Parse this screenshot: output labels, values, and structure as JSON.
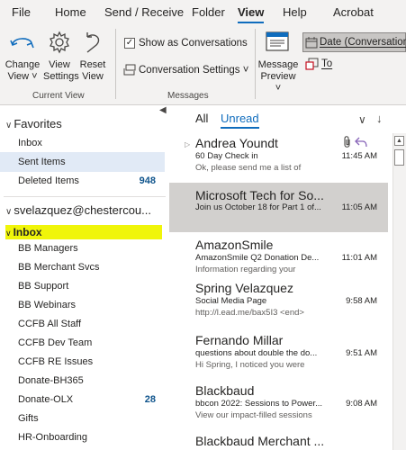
{
  "menu": {
    "tabs": [
      "File",
      "Home",
      "Send / Receive",
      "Folder",
      "View",
      "Help",
      "Acrobat"
    ]
  },
  "ribbon": {
    "change_view_label": "Change View ˅",
    "view_settings_label": "View Settings",
    "reset_view_label": "Reset View",
    "current_view_group": "Current View",
    "show_as_conversations_label": "Show as Conversations",
    "show_as_conversations_checked": true,
    "conversation_settings_label": "Conversation Settings ˅",
    "message_preview_label": "Message Preview ˅",
    "messages_group": "Messages",
    "date_conversations_label": "Date (Conversations)",
    "to_label": "To"
  },
  "folders": {
    "favorites_label": "Favorites",
    "favorites_items": [
      {
        "label": "Inbox",
        "count": ""
      },
      {
        "label": "Sent Items",
        "count": ""
      },
      {
        "label": "Deleted Items",
        "count": "948"
      }
    ],
    "account_label": "svelazquez@chestercou...",
    "inbox_label": "Inbox",
    "inbox_children": [
      {
        "label": "BB Managers",
        "count": ""
      },
      {
        "label": "BB Merchant Svcs",
        "count": ""
      },
      {
        "label": "BB Support",
        "count": ""
      },
      {
        "label": "BB Webinars",
        "count": ""
      },
      {
        "label": "CCFB All Staff",
        "count": ""
      },
      {
        "label": "CCFB Dev Team",
        "count": ""
      },
      {
        "label": "CCFB RE Issues",
        "count": ""
      },
      {
        "label": "Donate-BH365",
        "count": ""
      },
      {
        "label": "Donate-OLX",
        "count": "28"
      },
      {
        "label": "Gifts",
        "count": ""
      },
      {
        "label": "HR-Onboarding",
        "count": ""
      }
    ]
  },
  "message_list": {
    "tab_all": "All",
    "tab_unread": "Unread",
    "messages": [
      {
        "sender": "Andrea Youndt",
        "subject": "60 Day Check in",
        "preview": "Ok, please send me a list of",
        "time": "11:45 AM"
      },
      {
        "sender": "Microsoft Tech for So...",
        "subject": "Join us October 18 for Part 1 of...",
        "preview": "",
        "time": "11:05 AM"
      },
      {
        "sender": "AmazonSmile",
        "subject": "AmazonSmile Q2 Donation De...",
        "preview": "Information regarding your",
        "time": "11:01 AM"
      },
      {
        "sender": "Spring Velazquez",
        "subject": "Social Media Page",
        "preview": "http://l.ead.me/bax5I3 <end>",
        "time": "9:58 AM"
      },
      {
        "sender": "Fernando Millar",
        "subject": "questions about double the do...",
        "preview": "Hi Spring, I noticed you were",
        "time": "9:51 AM"
      },
      {
        "sender": "Blackbaud",
        "subject": "bbcon 2022: Sessions to Power...",
        "preview": "View our impact-filled sessions",
        "time": "9:08 AM"
      },
      {
        "sender": "Blackbaud Merchant ...",
        "subject": "",
        "preview": "",
        "time": ""
      }
    ]
  },
  "colors": {
    "accent": "#0f6cbd",
    "selection": "#d2d0ce",
    "inbox_highlight": "#f0f50a",
    "unread_count": "#0f548c"
  }
}
